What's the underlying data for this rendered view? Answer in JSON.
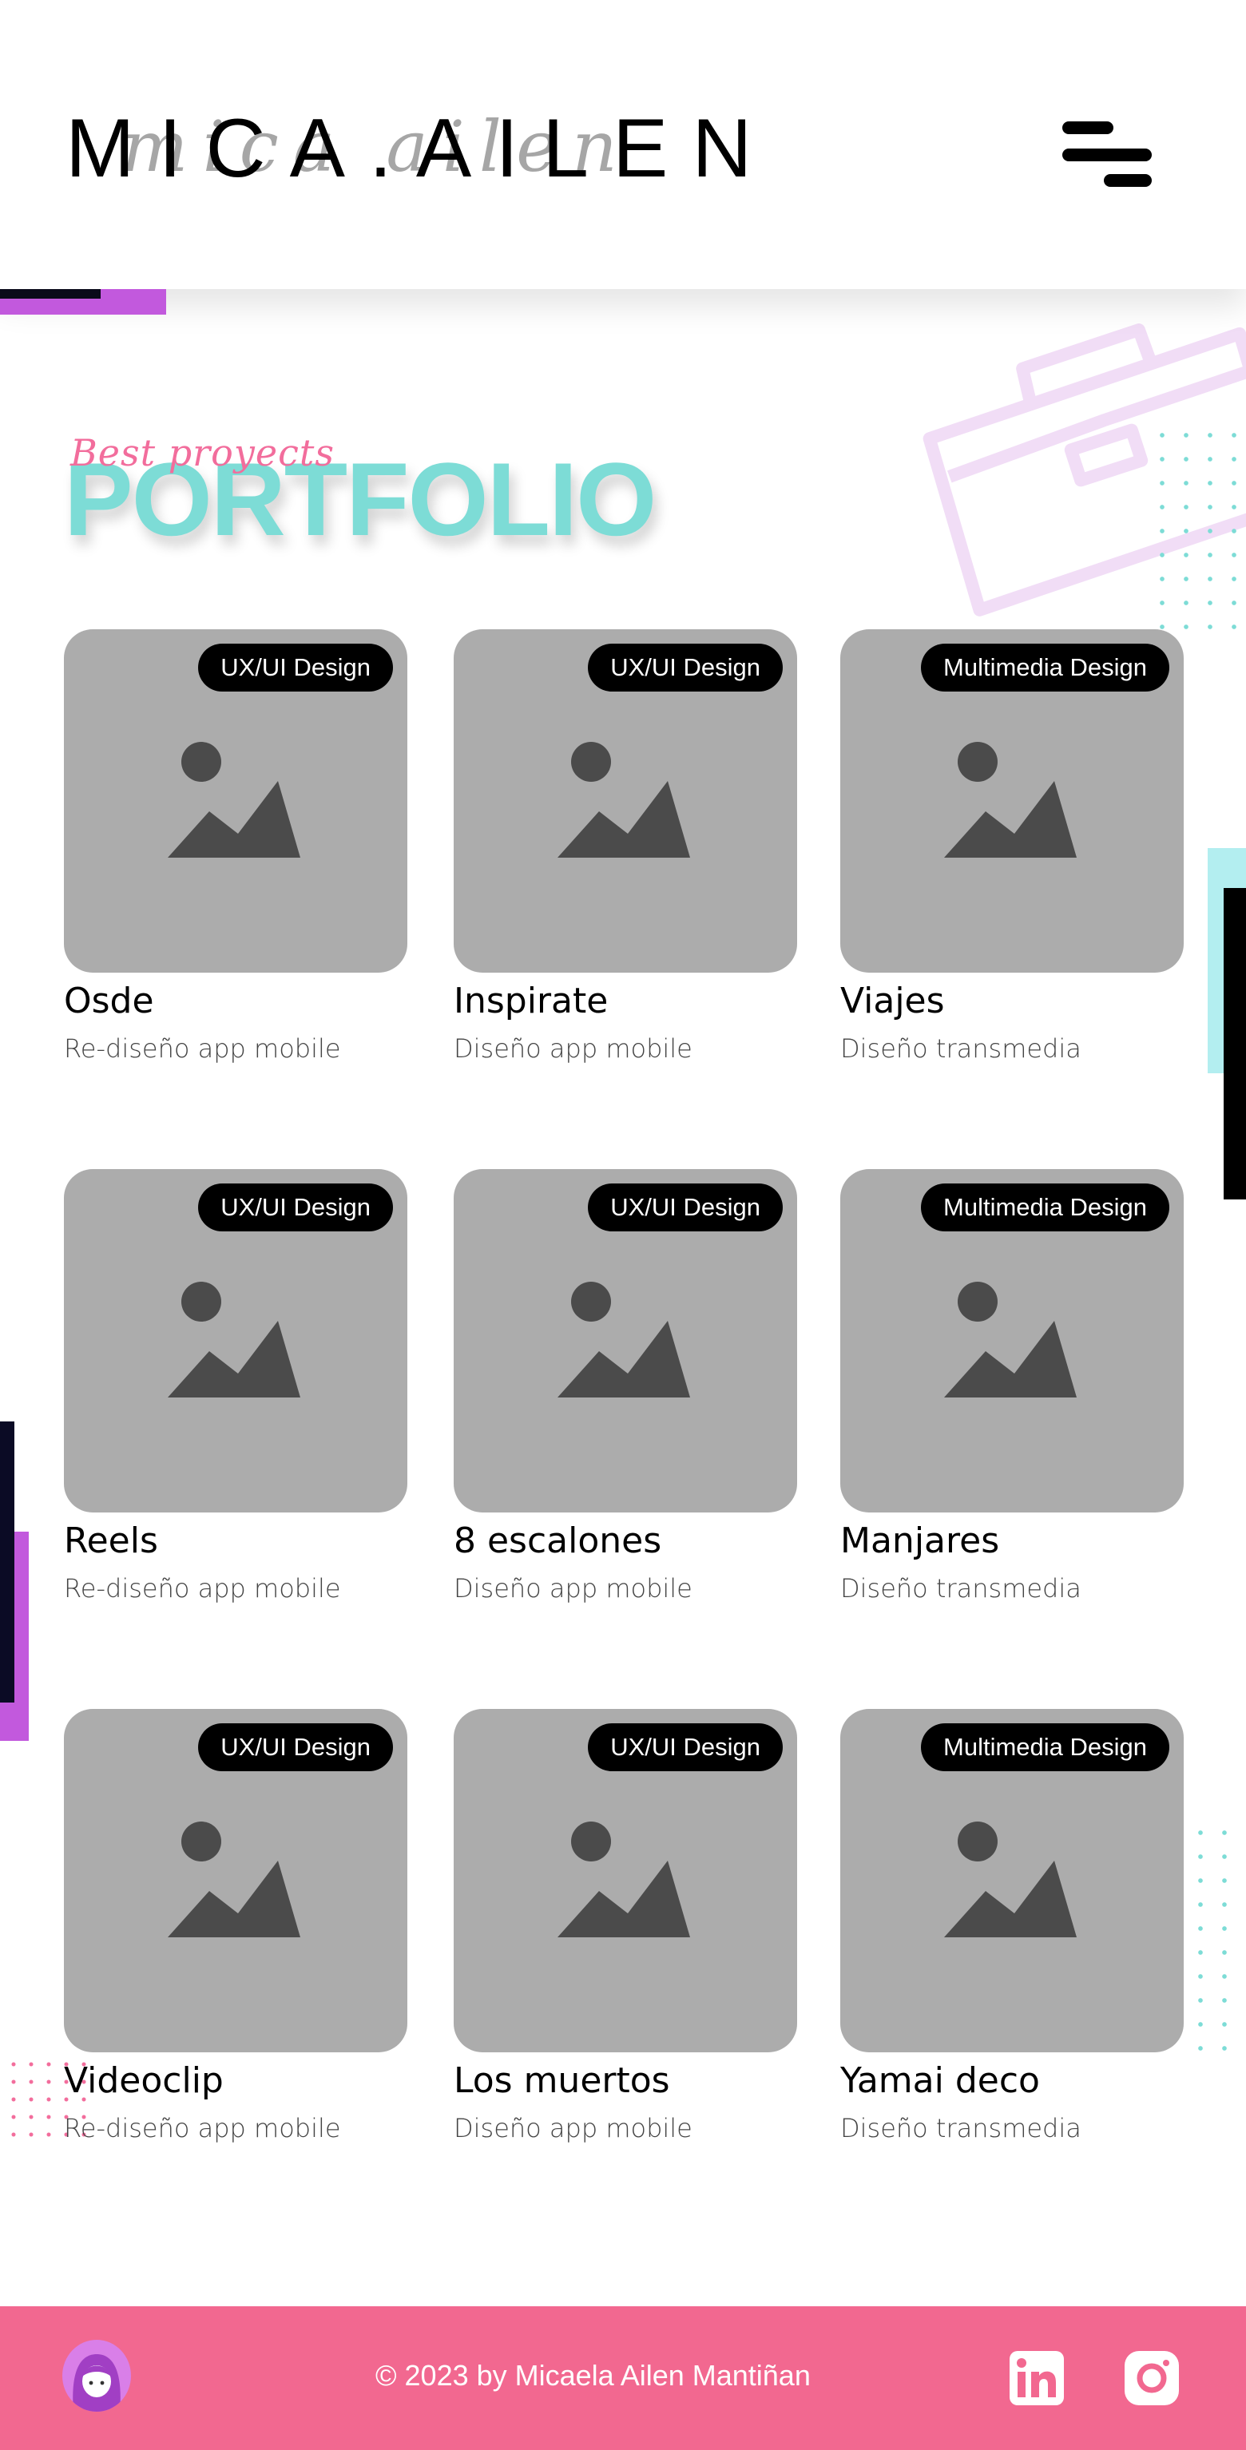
{
  "header": {
    "logo_text": "MICA.AILEN",
    "logo_script": "mica ailen",
    "menu_icon": "hamburger-menu-icon"
  },
  "section": {
    "script_label": "Best proyects",
    "title": "PORTFOLIO"
  },
  "projects": [
    {
      "tag": "UX/UI Design",
      "title": "Osde",
      "subtitle": "Re-diseño app mobile"
    },
    {
      "tag": "UX/UI Design",
      "title": "Inspirate",
      "subtitle": "Diseño app mobile"
    },
    {
      "tag": "Multimedia Design",
      "title": "Viajes",
      "subtitle": "Diseño transmedia"
    },
    {
      "tag": "UX/UI Design",
      "title": "Reels",
      "subtitle": "Re-diseño app mobile"
    },
    {
      "tag": "UX/UI Design",
      "title": "8 escalones",
      "subtitle": "Diseño app mobile"
    },
    {
      "tag": "Multimedia Design",
      "title": "Manjares",
      "subtitle": "Diseño transmedia"
    },
    {
      "tag": "UX/UI Design",
      "title": "Videoclip",
      "subtitle": "Re-diseño app mobile"
    },
    {
      "tag": "UX/UI Design",
      "title": "Los muertos",
      "subtitle": "Diseño app mobile"
    },
    {
      "tag": "Multimedia Design",
      "title": "Yamai deco",
      "subtitle": "Diseño transmedia"
    }
  ],
  "footer": {
    "copyright": "© 2023 by Micaela Ailen Mantiñan",
    "social": [
      "linkedin-icon",
      "instagram-icon"
    ]
  },
  "colors": {
    "accent_cyan": "#7ddcd6",
    "accent_pink": "#f26890",
    "accent_purple": "#c259dd",
    "thumb_placeholder": "#acacac"
  }
}
